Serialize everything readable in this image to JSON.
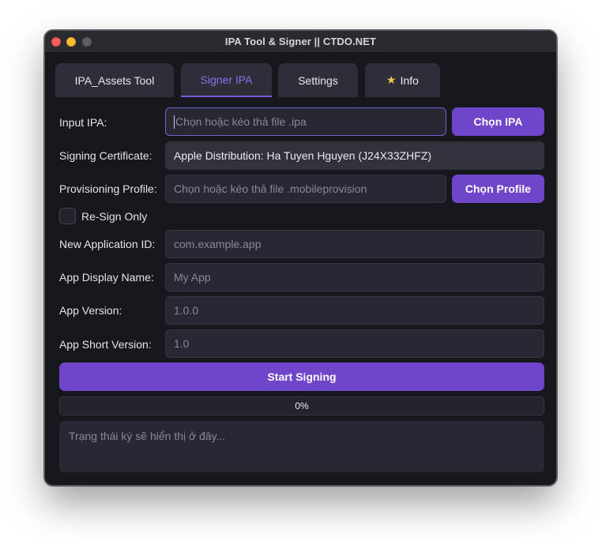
{
  "window": {
    "title": "IPA Tool & Signer || CTDO.NET"
  },
  "tabs": [
    {
      "label": "IPA_Assets Tool",
      "active": false
    },
    {
      "label": "Signer IPA",
      "active": true
    },
    {
      "label": "Settings",
      "active": false
    },
    {
      "label": "Info",
      "icon": "star-icon",
      "active": false
    }
  ],
  "form": {
    "input_ipa": {
      "label": "Input IPA:",
      "placeholder": "Chọn hoặc kéo thả file .ipa",
      "value": "",
      "button": "Chọn IPA"
    },
    "signing_certificate": {
      "label": "Signing Certificate:",
      "value": "Apple Distribution: Ha Tuyen Hguyen (J24X33ZHFZ)"
    },
    "provisioning_profile": {
      "label": "Provisioning Profile:",
      "placeholder": "Chọn hoặc kéo thả file .mobileprovision",
      "value": "",
      "button": "Chọn Profile"
    },
    "resign_only": {
      "label": "Re-Sign Only",
      "checked": false
    },
    "new_app_id": {
      "label": "New Application ID:",
      "placeholder": "com.example.app"
    },
    "display_name": {
      "label": "App Display Name:",
      "placeholder": "My App"
    },
    "app_version": {
      "label": "App Version:",
      "placeholder": "1.0.0"
    },
    "short_version": {
      "label": "App Short Version:",
      "placeholder": "1.0"
    }
  },
  "actions": {
    "start_label": "Start Signing"
  },
  "progress": {
    "value": 0,
    "text": "0%"
  },
  "status": {
    "placeholder": "Trạng thái ký sẽ hiển thị ở đây..."
  },
  "colors": {
    "accent": "#6f45c9",
    "active_tab_text": "#8f70e8",
    "background": "#17181e",
    "field": "#262832"
  }
}
